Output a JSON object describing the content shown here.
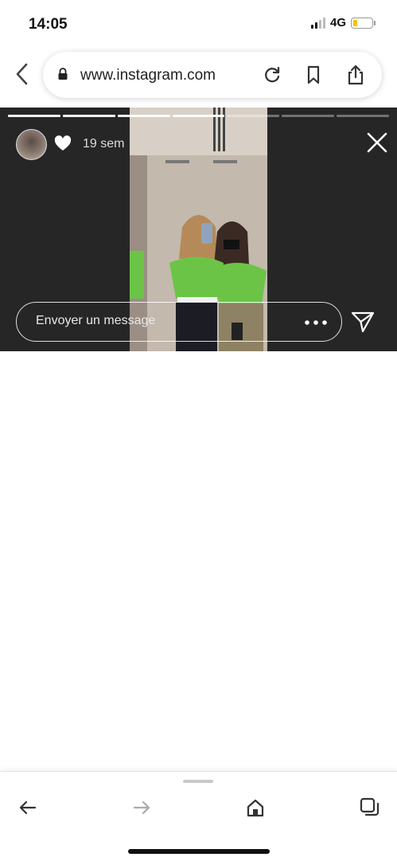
{
  "status_bar": {
    "time": "14:05",
    "network": "4G",
    "battery_color": "#f5c400"
  },
  "browser": {
    "url": "www.instagram.com"
  },
  "story": {
    "progress_total": 7,
    "progress_done": 4,
    "time_ago": "19 sem",
    "reply_placeholder": "Envoyer un message",
    "colors": {
      "background": "#262626"
    }
  },
  "icons": {
    "nav": [
      "back-arrow-icon",
      "lock-icon",
      "reload-icon",
      "bookmark-icon",
      "share-icon"
    ],
    "story": [
      "heart-icon",
      "close-icon",
      "more-dots-icon",
      "send-icon"
    ],
    "toolbar": [
      "back-icon",
      "forward-icon",
      "home-icon",
      "tabs-icon"
    ]
  }
}
